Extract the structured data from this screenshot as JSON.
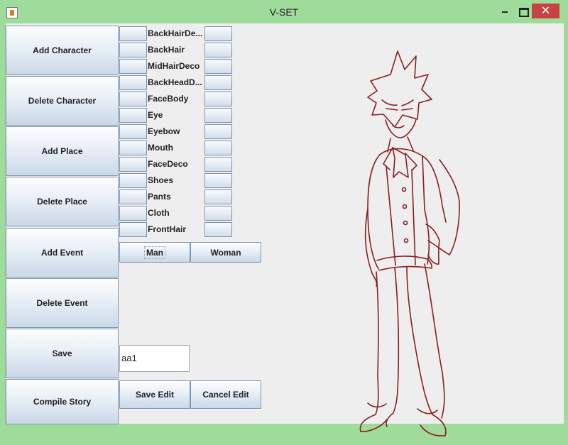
{
  "window": {
    "title": "V-SET",
    "close_label": "✕"
  },
  "left_buttons": [
    {
      "label": "Add Character"
    },
    {
      "label": "Delete Character"
    },
    {
      "label": "Add Place"
    },
    {
      "label": "Delete Place"
    },
    {
      "label": "Add Event"
    },
    {
      "label": "Delete Event"
    },
    {
      "label": "Save"
    },
    {
      "label": "Compile Story"
    }
  ],
  "layers": [
    {
      "label": "BackHairDe..."
    },
    {
      "label": "BackHair"
    },
    {
      "label": "MidHairDeco"
    },
    {
      "label": "BackHeadD..."
    },
    {
      "label": "FaceBody"
    },
    {
      "label": "Eye"
    },
    {
      "label": "Eyebow"
    },
    {
      "label": "Mouth"
    },
    {
      "label": "FaceDeco"
    },
    {
      "label": "Shoes"
    },
    {
      "label": "Pants"
    },
    {
      "label": "Cloth"
    },
    {
      "label": "FrontHair"
    }
  ],
  "gender_tabs": {
    "man": "Man",
    "woman": "Woman"
  },
  "name_field": {
    "value": "aa1"
  },
  "edit_buttons": {
    "save": "Save Edit",
    "cancel": "Cancel Edit"
  },
  "colors": {
    "title_bar": "#9fdb9b",
    "close_button": "#c74343",
    "line_art": "#8a1f1f"
  },
  "icons": {
    "app": "java-cup-icon",
    "minimize": "minimize-icon",
    "maximize": "maximize-icon",
    "close": "close-icon"
  }
}
